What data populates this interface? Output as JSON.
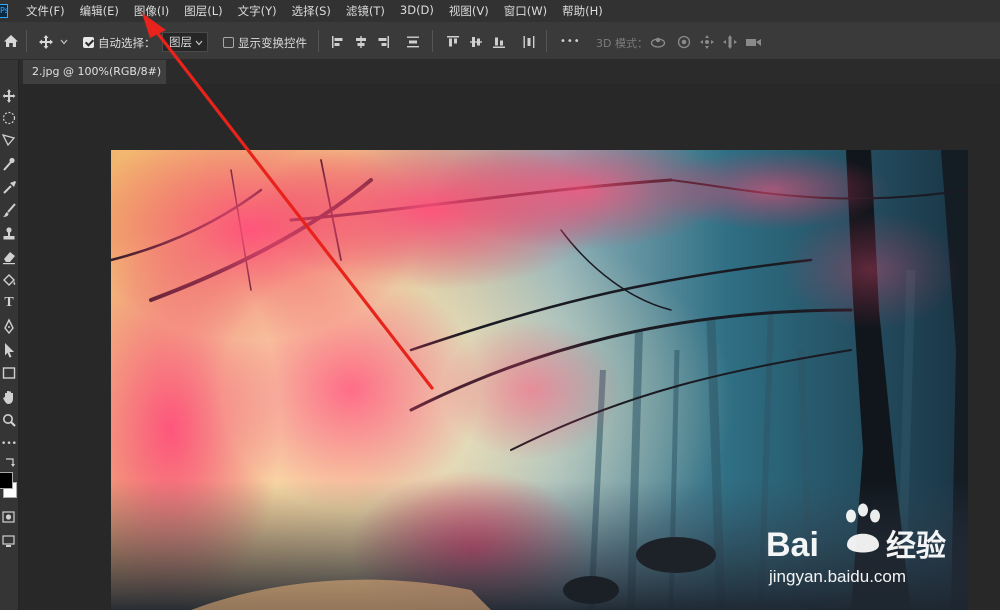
{
  "app": {
    "logo_text": "Ps"
  },
  "menu": {
    "items": [
      "文件(F)",
      "编辑(E)",
      "图像(I)",
      "图层(L)",
      "文字(Y)",
      "选择(S)",
      "滤镜(T)",
      "3D(D)",
      "视图(V)",
      "窗口(W)",
      "帮助(H)"
    ]
  },
  "options": {
    "auto_select_label": "自动选择：",
    "auto_select_checked": true,
    "layer_select_value": "图层",
    "show_transform_label": "显示变换控件",
    "show_transform_checked": false,
    "more_label": "•••",
    "mode_3d_label": "3D 模式："
  },
  "document": {
    "tab_title": "2.jpg @ 100%(RGB/8#)"
  },
  "watermark": {
    "brand_left": "Bai",
    "brand_right": "经验",
    "url": "jingyan.baidu.com"
  },
  "colors": {
    "annotation_arrow": "#e8231b",
    "accent": "#31a8ff"
  }
}
